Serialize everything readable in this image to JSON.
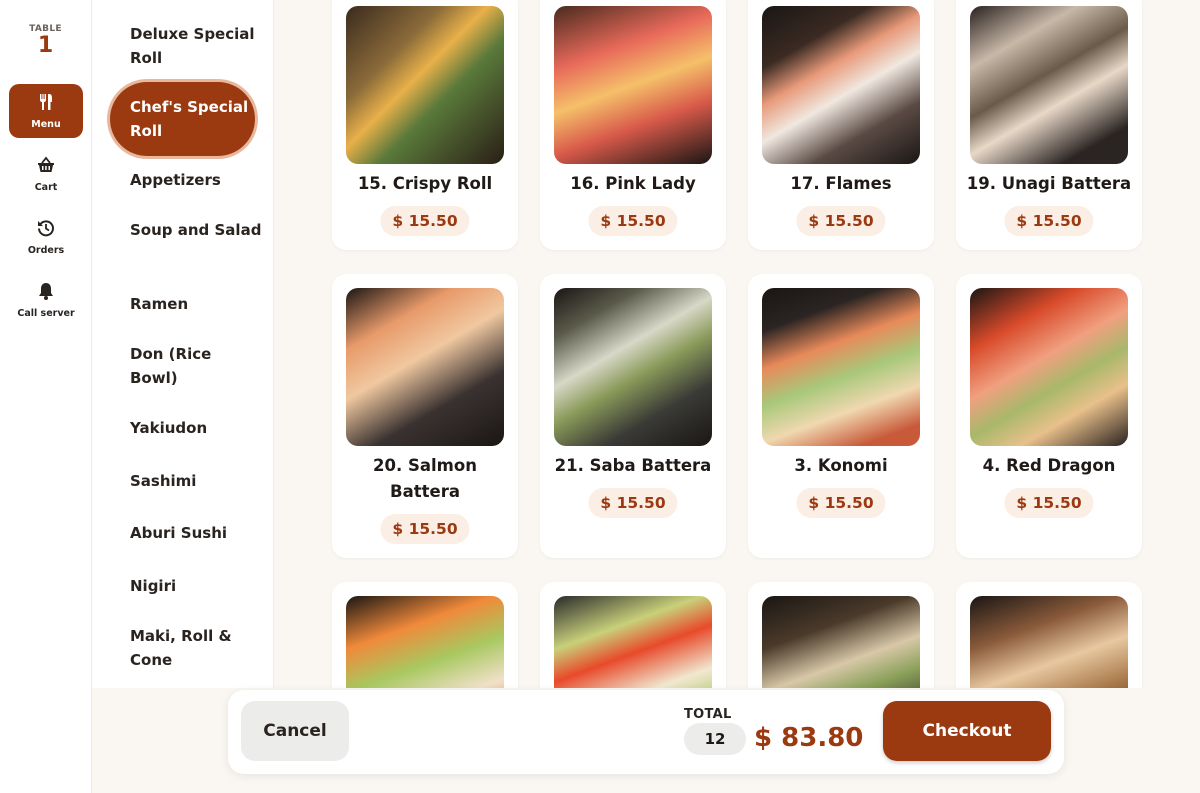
{
  "table": {
    "label": "TABLE",
    "number": "1"
  },
  "nav": [
    {
      "label": "Menu",
      "icon": "fork-knife-icon",
      "active": true
    },
    {
      "label": "Cart",
      "icon": "basket-icon",
      "active": false
    },
    {
      "label": "Orders",
      "icon": "history-icon",
      "active": false
    },
    {
      "label": "Call server",
      "icon": "bell-icon",
      "active": false
    }
  ],
  "categories": [
    {
      "label": "Deluxe Special Roll"
    },
    {
      "label": "Chef's Special Roll",
      "active": true
    },
    {
      "label": "Appetizers"
    },
    {
      "label": "Soup and Salad"
    },
    {
      "label": "Ramen"
    },
    {
      "label": "Don (Rice Bowl)"
    },
    {
      "label": "Yakiudon"
    },
    {
      "label": "Sashimi"
    },
    {
      "label": "Aburi Sushi"
    },
    {
      "label": "Nigiri"
    },
    {
      "label": "Maki, Roll & Cone"
    }
  ],
  "items": [
    {
      "name": "15. Crispy Roll",
      "price": "$ 15.50"
    },
    {
      "name": "16. Pink Lady",
      "price": "$ 15.50"
    },
    {
      "name": "17. Flames",
      "price": "$ 15.50"
    },
    {
      "name": "19. Unagi Battera",
      "price": "$ 15.50"
    },
    {
      "name": "20. Salmon Battera",
      "price": "$ 15.50"
    },
    {
      "name": "21. Saba Battera",
      "price": "$ 15.50"
    },
    {
      "name": "3. Konomi",
      "price": "$ 15.50"
    },
    {
      "name": "4. Red Dragon",
      "price": "$ 15.50"
    },
    {
      "name": "",
      "price": ""
    },
    {
      "name": "",
      "price": ""
    },
    {
      "name": "",
      "price": ""
    },
    {
      "name": "",
      "price": ""
    }
  ],
  "footer": {
    "cancel_label": "Cancel",
    "total_label": "TOTAL",
    "item_count": "12",
    "total_amount": "$ 83.80",
    "checkout_label": "Checkout"
  },
  "colors": {
    "accent": "#9b3a10",
    "price_bg": "#fbeee4",
    "panel_bg": "#faf7f2"
  }
}
